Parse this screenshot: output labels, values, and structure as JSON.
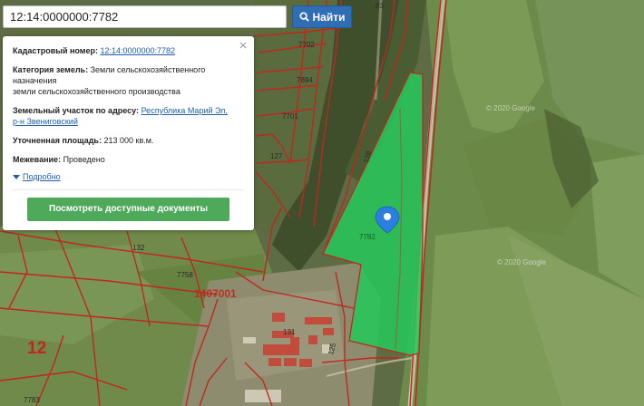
{
  "search": {
    "value": "12:14:0000000:7782",
    "button_label": "Найти"
  },
  "popup": {
    "cadastral_label": "Кадастровый номер:",
    "cadastral_value": "12:14:0000000:7782",
    "category_label": "Категория земель:",
    "category_value_1": "Земли сельскохозяйственного",
    "category_value_2": "назначения",
    "category_value_3": "земли сельскохозяйственного производства",
    "address_label": "Земельный участок по адресу:",
    "address_value_1": "Республика Марий Эл,",
    "address_value_2": "р-н Звениговский",
    "area_label": "Уточненная площадь:",
    "area_value": "213 000 кв.м.",
    "survey_label": "Межевание:",
    "survey_value": "Проведено",
    "more_link": "Подробно",
    "docs_button": "Посмотреть доступные документы",
    "close": "×"
  },
  "map": {
    "parcel_labels": [
      "7702",
      "7694",
      "7701",
      "127",
      "128",
      "132",
      "7758",
      "1407001",
      "7782",
      "131",
      "125",
      "12",
      "7783",
      "83"
    ],
    "watermarks": [
      "© 2020 Google",
      "© 2020 Google"
    ],
    "colors": {
      "parcel_fill": "#25c85a",
      "boundary": "#c1271f",
      "marker": "#2a7fe0"
    }
  }
}
